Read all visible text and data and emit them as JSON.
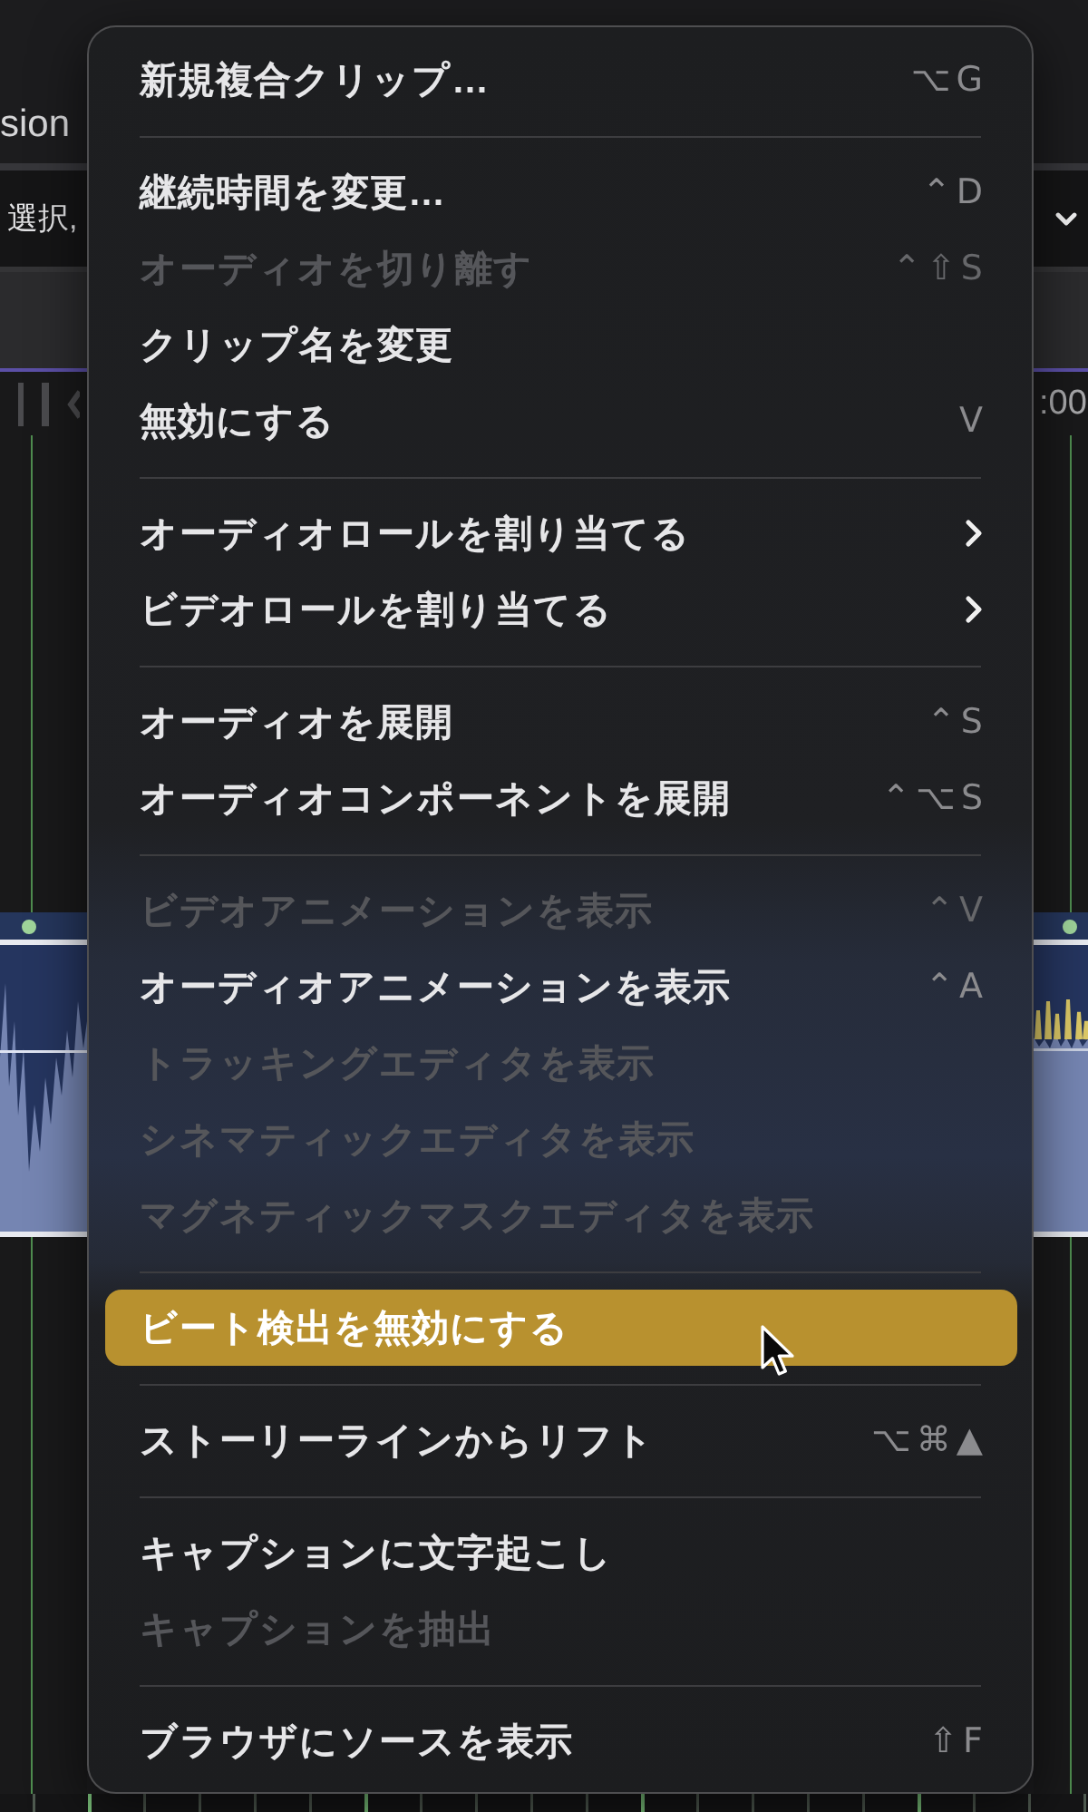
{
  "background": {
    "tab_label": "sion",
    "toolbar_text": "選択,",
    "ruler_time": ":00"
  },
  "context_menu": {
    "sections": [
      {
        "items": [
          {
            "label": "新規複合クリップ…",
            "kind": "command",
            "shortcut": "⌥G",
            "disabled": false,
            "selected": false
          }
        ]
      },
      {
        "items": [
          {
            "label": "継続時間を変更…",
            "kind": "command",
            "shortcut": "⌃D",
            "disabled": false,
            "selected": false
          },
          {
            "label": "オーディオを切り離す",
            "kind": "command",
            "shortcut": "⌃⇧S",
            "disabled": true,
            "selected": false
          },
          {
            "label": "クリップ名を変更",
            "kind": "command",
            "disabled": false,
            "selected": false
          },
          {
            "label": "無効にする",
            "kind": "command",
            "shortcut": "V",
            "disabled": false,
            "selected": false
          }
        ]
      },
      {
        "items": [
          {
            "label": "オーディオロールを割り当てる",
            "kind": "submenu",
            "disabled": false,
            "selected": false
          },
          {
            "label": "ビデオロールを割り当てる",
            "kind": "submenu",
            "disabled": false,
            "selected": false
          }
        ]
      },
      {
        "items": [
          {
            "label": "オーディオを展開",
            "kind": "command",
            "shortcut": "⌃S",
            "disabled": false,
            "selected": false
          },
          {
            "label": "オーディオコンポーネントを展開",
            "kind": "command",
            "shortcut": "⌃⌥S",
            "disabled": false,
            "selected": false
          }
        ]
      },
      {
        "items": [
          {
            "label": "ビデオアニメーションを表示",
            "kind": "command",
            "shortcut": "⌃V",
            "disabled": true,
            "selected": false
          },
          {
            "label": "オーディオアニメーションを表示",
            "kind": "command",
            "shortcut": "⌃A",
            "disabled": false,
            "selected": false
          },
          {
            "label": "トラッキングエディタを表示",
            "kind": "command",
            "disabled": true,
            "selected": false
          },
          {
            "label": "シネマティックエディタを表示",
            "kind": "command",
            "disabled": true,
            "selected": false
          },
          {
            "label": "マグネティックマスクエディタを表示",
            "kind": "command",
            "disabled": true,
            "selected": false
          }
        ]
      },
      {
        "items": [
          {
            "label": "ビート検出を無効にする",
            "kind": "command",
            "disabled": false,
            "selected": true
          }
        ]
      },
      {
        "items": [
          {
            "label": "ストーリーラインからリフト",
            "kind": "command",
            "shortcut": "⌥⌘▲",
            "disabled": false,
            "selected": false
          }
        ]
      },
      {
        "items": [
          {
            "label": "キャプションに文字起こし",
            "kind": "command",
            "disabled": false,
            "selected": false
          },
          {
            "label": "キャプションを抽出",
            "kind": "command",
            "disabled": true,
            "selected": false
          }
        ]
      },
      {
        "items": [
          {
            "label": "ブラウザにソースを表示",
            "kind": "command",
            "shortcut": "⇧F",
            "disabled": false,
            "selected": false
          }
        ]
      }
    ]
  }
}
